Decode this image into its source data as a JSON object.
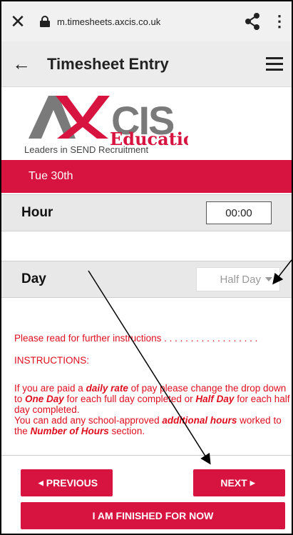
{
  "browser": {
    "url": "m.timesheets.axcis.co.uk",
    "close_icon": "close-icon",
    "share_icon": "share-icon",
    "more_icon": "more-vert-icon"
  },
  "appbar": {
    "title": "Timesheet Entry",
    "back_icon": "arrow-back-icon",
    "menu_icon": "hamburger-menu-icon"
  },
  "logo": {
    "brand": "AXCIS",
    "subbrand": "Education",
    "tagline": "Leaders in SEND Recruitment"
  },
  "date_label": "Tue 30th",
  "hour": {
    "label": "Hour",
    "value": "00:00"
  },
  "day": {
    "label": "Day",
    "selected": "Half Day"
  },
  "instructions": {
    "link_text": "Please read for further instructions . . . . . . . . . . . . . . . . . .",
    "heading": "INSTRUCTIONS:",
    "p1_a": "If you are paid a ",
    "p1_b": "daily rate",
    "p1_c": " of pay please change the drop down to ",
    "p1_d": "One Day",
    "p1_e": " for each full day completed or ",
    "p1_f": "Half Day",
    "p1_g": " for each half day completed.",
    "p2_a": "You can add any school-approved ",
    "p2_b": "additional hours",
    "p2_c": " worked to the ",
    "p2_d": "Number of Hours",
    "p2_e": " section."
  },
  "buttons": {
    "previous": "PREVIOUS",
    "next": "NEXT",
    "finish": "I AM FINISHED FOR NOW"
  },
  "colors": {
    "brand_red": "#d7143f",
    "instruction_red": "#e00e1f",
    "row_gray": "#e8e8e8"
  }
}
